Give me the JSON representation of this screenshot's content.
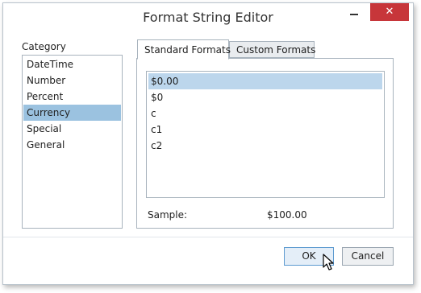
{
  "window": {
    "title": "Format String Editor",
    "close_glyph": "✕",
    "minimize_icon": "minimize-icon"
  },
  "category": {
    "label": "Category",
    "items": [
      "DateTime",
      "Number",
      "Percent",
      "Currency",
      "Special",
      "General"
    ],
    "selected": "Currency"
  },
  "tabs": [
    {
      "label": "Standard Formats",
      "active": true
    },
    {
      "label": "Custom Formats",
      "active": false
    }
  ],
  "formats": {
    "items": [
      "$0.00",
      "$0",
      "c",
      "c1",
      "c2"
    ],
    "selected": "$0.00"
  },
  "sample": {
    "label": "Sample:",
    "value": "$100.00"
  },
  "buttons": {
    "ok": "OK",
    "cancel": "Cancel"
  },
  "colors": {
    "close_button": "#c7363a",
    "category_selection": "#9bc2e0",
    "format_selection": "#bcd6ec"
  }
}
